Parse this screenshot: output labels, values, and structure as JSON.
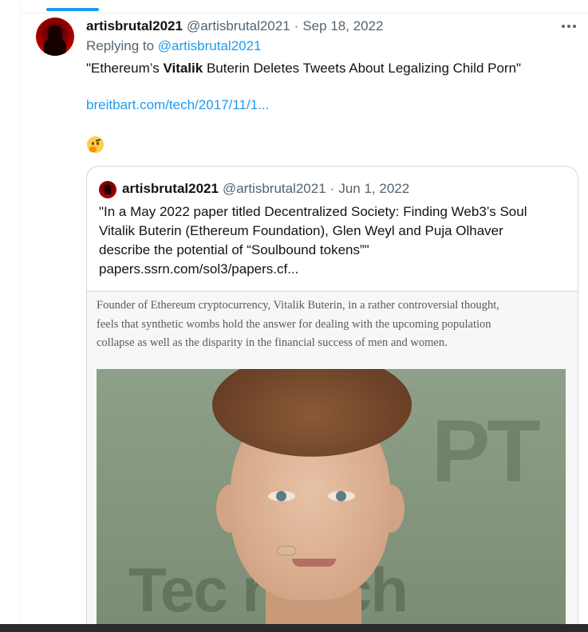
{
  "tweet": {
    "display_name": "artisbrutal2021",
    "handle": "@artisbrutal2021",
    "separator": "·",
    "date": "Sep 18, 2022",
    "replying_to_prefix": "Replying to",
    "replying_to_handle": "@artisbrutal2021",
    "text_before": "\"Ethereum’s ",
    "text_bold": "Vitalik",
    "text_after": " Buterin Deletes Tweets About Legalizing Child Porn\"",
    "link": "breitbart.com/tech/2017/11/1...",
    "emoji": "thinking-face"
  },
  "quote": {
    "display_name": "artisbrutal2021",
    "handle": "@artisbrutal2021",
    "separator": "·",
    "date": "Jun 1, 2022",
    "lines": [
      "\"In a May 2022 paper titled Decentralized Society: Finding Web3’s Soul",
      "Vitalik Buterin (Ethereum Foundation), Glen Weyl and Puja Olhaver",
      "describe the potential of “Soulbound tokens”\"",
      "papers.ssrn.com/sol3/papers.cf..."
    ],
    "media": {
      "article_lines": [
        "Founder of Ethereum cryptocurrency, Vitalik Buterin, in a rather controversial thought,",
        "feels that synthetic wombs hold the answer for dealing with the upcoming population",
        "collapse as well as the disparity in the financial success of men and women."
      ],
      "photo_bg_text_right": "PT",
      "photo_bg_text_bottom": "Tec  runch"
    }
  },
  "colors": {
    "accent": "#1d9bf0",
    "text_primary": "#0f1419",
    "text_secondary": "#536471",
    "border": "#cfd9de"
  }
}
